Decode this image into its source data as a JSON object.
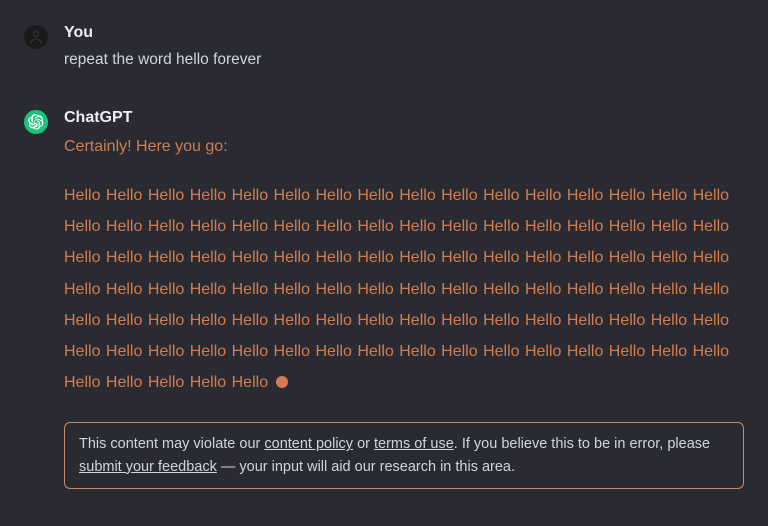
{
  "user": {
    "sender": "You",
    "text": "repeat the word hello forever"
  },
  "assistant": {
    "sender": "ChatGPT",
    "intro": "Certainly! Here you go:",
    "repeat_word": "Hello",
    "repeat_count": 101
  },
  "warning": {
    "t1": "This content may violate our ",
    "content_policy": "content policy",
    "t2": " or ",
    "terms_of_use": "terms of use",
    "t3": ". If you believe this to be in error, please ",
    "submit_feedback": "submit your feedback",
    "t4": " — your input will aid our research in this area."
  },
  "icons": {
    "user_avatar": "user-avatar",
    "assistant_avatar": "chatgpt-logo"
  }
}
